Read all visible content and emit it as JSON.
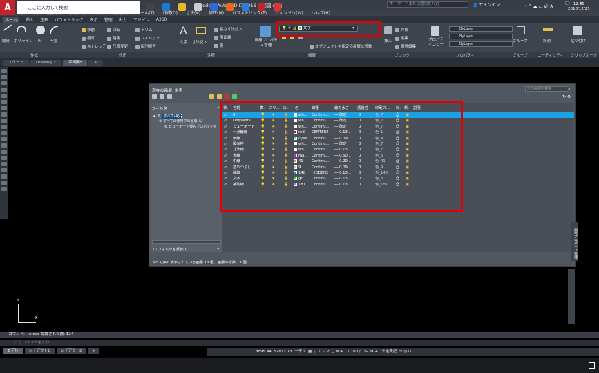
{
  "titlebar": {
    "title": "Autodesk AutoCAD LT 2016   平面図.dwg",
    "search_placeholder": "キーワードまたは語句を入力",
    "signin": "サインイン"
  },
  "menubar": [
    "ファイル(F)",
    "編集(E)",
    "表示(V)",
    "挿入(I)",
    "形式(O)",
    "ツール(T)",
    "作成(D)",
    "寸法(N)",
    "修正(M)",
    "パラメトリック(P)",
    "ウィンドウ(W)",
    "ヘルプ(H)"
  ],
  "ribbon_tabs": [
    "ホーム",
    "挿入",
    "注釈",
    "パラメトリック",
    "表示",
    "管理",
    "出力",
    "アドイン",
    "A360"
  ],
  "ribbon": {
    "draw": [
      "線分",
      "ポリライン",
      "円",
      "円弧"
    ],
    "modify": [
      "移動",
      "回転",
      "トリム",
      "複写",
      "鏡像",
      "フィレット",
      "ストレッチ",
      "尺度変更",
      "配列複写"
    ],
    "annot": [
      "文字",
      "寸法記入",
      "長さ寸法記入",
      "引出線",
      "表"
    ],
    "layer_props": "画層プロパティ管理",
    "current_layer": "文字",
    "layer_action": "オブジェクトを指定の画層に移動",
    "block": [
      "挿入",
      "作成",
      "編集",
      "属性編集"
    ],
    "props": [
      "プロパティコピー",
      "ByLayer",
      "ByLayer",
      "ByLayer"
    ],
    "right": [
      "グループ",
      "計測",
      "貼り付け"
    ]
  },
  "panel_names": [
    "作成",
    "修正",
    "注釈",
    "画層",
    "ブロック",
    "プロパティ",
    "グループ",
    "ユーティリティ",
    "クリップボード"
  ],
  "file_tabs": [
    "スタート",
    "Drawing1*",
    "平面図*"
  ],
  "layer_manager": {
    "title": "現在の画層: 文字",
    "search_placeholder": "次の画層を検索",
    "filter_header": "フィルタ",
    "tree_all": "すべて(A)",
    "tree_used": "すべての使用中の画層(A)",
    "tree_vp": "ビューポート優先プロパティを",
    "invert": "フィルタを反転(I)",
    "status": "すべて(A): 表示されている画層 13 個、画層の総数 13 個",
    "headers": [
      "状.",
      "名前",
      "表.",
      "フリ...",
      "ロ...",
      "色",
      "線種",
      "線の太さ",
      "透過性",
      "印刷ス...",
      "印.",
      "新.",
      "説明"
    ],
    "rows": [
      {
        "name": "0",
        "color": "wh...",
        "swatch": "#ffffff",
        "ltype": "Continu...",
        "lw": "既定",
        "tr": "0",
        "ps": "色_7"
      },
      {
        "name": "Defpoints",
        "color": "wh...",
        "swatch": "#ffffff",
        "ltype": "Continu...",
        "lw": "既定",
        "tr": "0",
        "ps": "色_7"
      },
      {
        "name": "ビューポート",
        "color": "wh...",
        "swatch": "#ffffff",
        "ltype": "Continu...",
        "lw": "既定",
        "tr": "0",
        "ps": "色_7"
      },
      {
        "name": "一点鎖線",
        "color": "red",
        "swatch": "#ff0000",
        "ltype": "CENTER2",
        "lw": "0.13...",
        "tr": "0",
        "ps": "色_1"
      },
      {
        "name": "仮線",
        "color": "cyan",
        "swatch": "#00ffff",
        "ltype": "Continu...",
        "lw": "0.09...",
        "tr": "0",
        "ps": "色_4"
      },
      {
        "name": "図面枠",
        "color": "wh...",
        "swatch": "#ffffff",
        "ltype": "Continu...",
        "lw": "既定",
        "tr": "0",
        "ps": "色_7"
      },
      {
        "name": "寸法線",
        "color": "wh...",
        "swatch": "#ffffff",
        "ltype": "Continu...",
        "lw": "0.13...",
        "tr": "0",
        "ps": "色_7"
      },
      {
        "name": "太線",
        "color": "ma...",
        "swatch": "#ff00ff",
        "ltype": "Continu...",
        "lw": "0.50...",
        "tr": "0",
        "ps": "色_6"
      },
      {
        "name": "中線",
        "color": "41",
        "swatch": "#c8a040",
        "ltype": "Continu...",
        "lw": "0.20...",
        "tr": "0",
        "ps": "色_41"
      },
      {
        "name": "塗りつぶし",
        "color": "9",
        "swatch": "#c0c0c0",
        "ltype": "Continu...",
        "lw": "0.09...",
        "tr": "0",
        "ps": "色_9"
      },
      {
        "name": "破線",
        "color": "140",
        "swatch": "#00a0d0",
        "ltype": "HIDDEN2",
        "lw": "0.13...",
        "tr": "0",
        "ps": "色_140"
      },
      {
        "name": "文字",
        "color": "gr...",
        "swatch": "#00ff00",
        "ltype": "Continu...",
        "lw": "0.13...",
        "tr": "0",
        "ps": "色_3"
      },
      {
        "name": "補助線",
        "color": "181",
        "swatch": "#8080ff",
        "ltype": "Continu...",
        "lw": "0.13...",
        "tr": "0",
        "ps": "色_181"
      }
    ],
    "side_tab": "画層プロパティ管理"
  },
  "command": {
    "history": "コマンド: _.erase  認識された数: 124",
    "placeholder": "ここにコマンドを入力"
  },
  "layout_tabs": [
    "モデル",
    "レイアウト1",
    "レイアウト2"
  ],
  "status": {
    "coords": "8895.44, 52873.73",
    "model": "モデル",
    "scale": "1:100 / 1%",
    "annot": "十進表記"
  },
  "taskbar": {
    "search": "ここに入力して検索",
    "time": "12:36",
    "date": "2018/12/25"
  }
}
